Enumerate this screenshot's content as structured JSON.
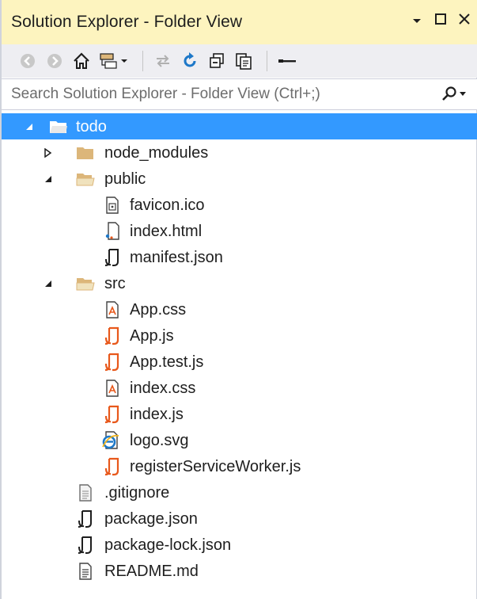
{
  "window": {
    "title": "Solution Explorer - Folder View"
  },
  "search": {
    "placeholder": "Search Solution Explorer - Folder View (Ctrl+;)"
  },
  "colors": {
    "titlebar": "#fdf4bf",
    "toolbar": "#eeeef2",
    "selection": "#3399ff",
    "folder": "#dcb67a",
    "js_icon": "#e8581b",
    "ie_icon": "#1e78c8"
  },
  "tree": {
    "root": {
      "label": "todo",
      "icon": "folder-open-icon",
      "expanded": true
    },
    "node_modules": {
      "label": "node_modules",
      "icon": "folder-icon",
      "expanded": false
    },
    "public": {
      "label": "public",
      "icon": "folder-open-icon",
      "expanded": true,
      "files": [
        {
          "label": "favicon.ico",
          "icon": "image-file-icon"
        },
        {
          "label": "index.html",
          "icon": "html-file-icon"
        },
        {
          "label": "manifest.json",
          "icon": "json-file-icon"
        }
      ]
    },
    "src": {
      "label": "src",
      "icon": "folder-open-icon",
      "expanded": true,
      "files": [
        {
          "label": "App.css",
          "icon": "css-file-icon"
        },
        {
          "label": "App.js",
          "icon": "js-file-icon"
        },
        {
          "label": "App.test.js",
          "icon": "js-file-icon"
        },
        {
          "label": "index.css",
          "icon": "css-file-icon"
        },
        {
          "label": "index.js",
          "icon": "js-file-icon"
        },
        {
          "label": "logo.svg",
          "icon": "svg-ie-file-icon"
        },
        {
          "label": "registerServiceWorker.js",
          "icon": "js-file-icon"
        }
      ]
    },
    "root_files": [
      {
        "label": ".gitignore",
        "icon": "text-file-icon"
      },
      {
        "label": "package.json",
        "icon": "json-file-icon"
      },
      {
        "label": "package-lock.json",
        "icon": "json-file-icon"
      },
      {
        "label": "README.md",
        "icon": "markdown-file-icon"
      }
    ]
  }
}
